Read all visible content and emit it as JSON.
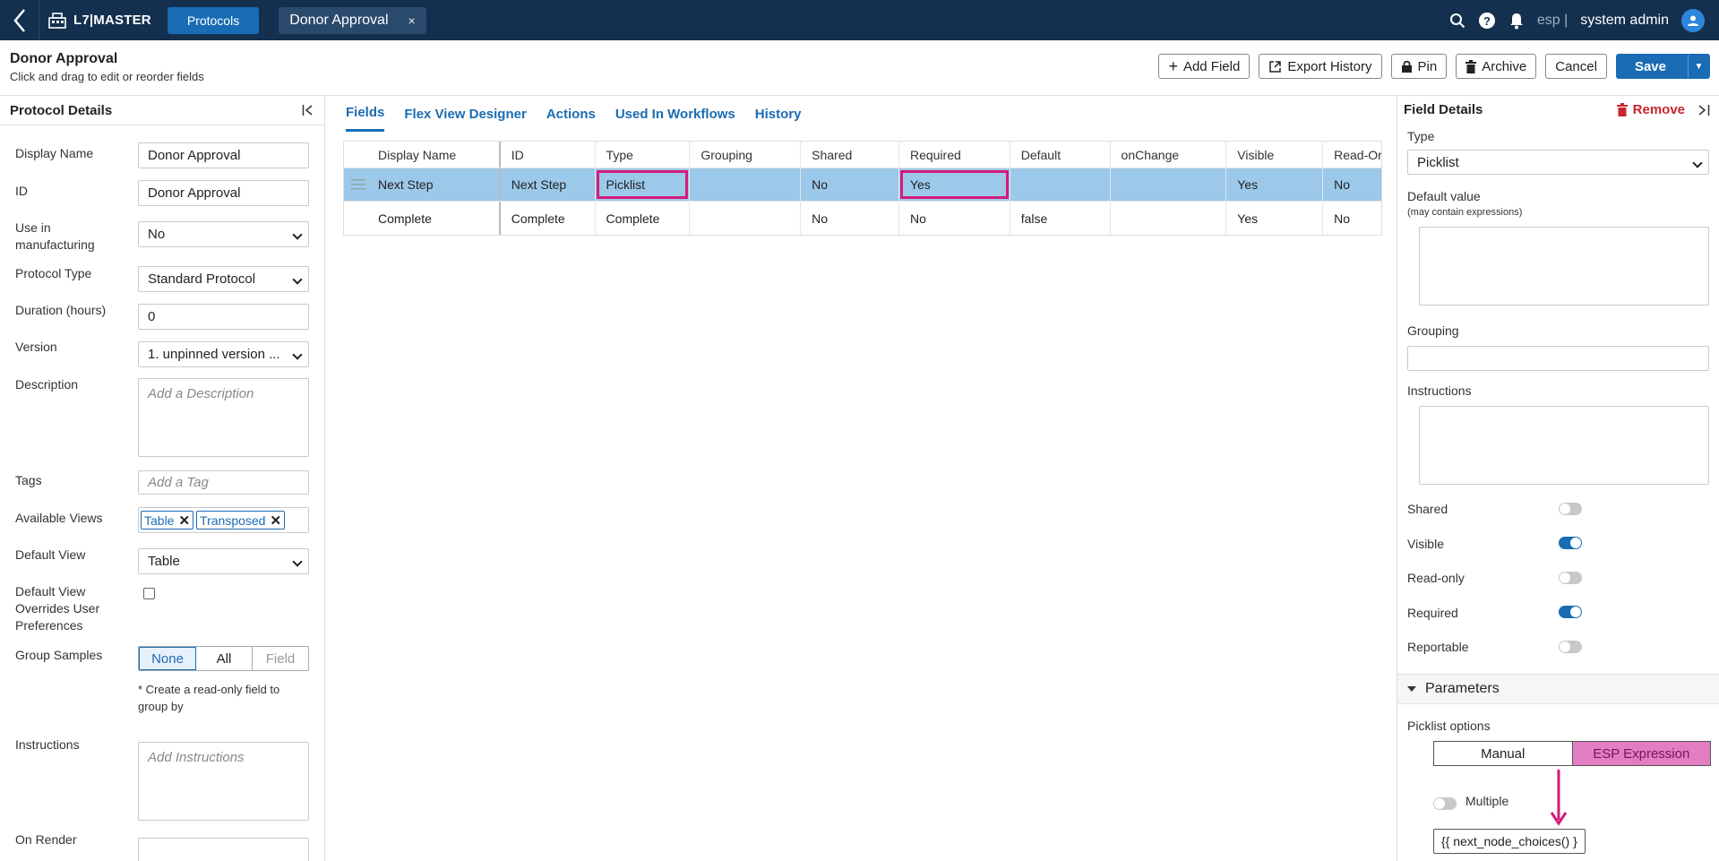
{
  "topbar": {
    "app_name": "L7|MASTER",
    "protocols_label": "Protocols",
    "doc_tab": "Donor Approval",
    "close_glyph": "×",
    "lang": "esp |",
    "user": "system admin"
  },
  "header": {
    "title": "Donor Approval",
    "subtitle": "Click and drag to edit or reorder fields",
    "buttons": {
      "add_field": "Add Field",
      "export_history": "Export History",
      "pin": "Pin",
      "archive": "Archive",
      "cancel": "Cancel",
      "save": "Save"
    }
  },
  "left": {
    "title": "Protocol Details",
    "display_name_label": "Display Name",
    "display_name": "Donor Approval",
    "id_label": "ID",
    "id": "Donor Approval",
    "manufacturing_label": "Use in manufacturing",
    "manufacturing": "No",
    "protocol_type_label": "Protocol Type",
    "protocol_type": "Standard Protocol",
    "duration_label": "Duration (hours)",
    "duration": "0",
    "version_label": "Version",
    "version": "1. unpinned version ...",
    "description_label": "Description",
    "description_placeholder": "Add a Description",
    "tags_label": "Tags",
    "tags_placeholder": "Add a Tag",
    "views_label": "Available Views",
    "views": [
      "Table",
      "Transposed"
    ],
    "default_view_label": "Default View",
    "default_view": "Table",
    "override_label": "Default View Overrides User Preferences",
    "group_label": "Group Samples",
    "group_options": [
      "None",
      "All",
      "Field"
    ],
    "group_note": "* Create a read-only field to group by",
    "instructions_label": "Instructions",
    "instructions_placeholder": "Add Instructions",
    "on_render_label": "On Render"
  },
  "center": {
    "tabs": [
      "Fields",
      "Flex View Designer",
      "Actions",
      "Used In Workflows",
      "History"
    ],
    "columns": [
      "Display Name",
      "ID",
      "Type",
      "Grouping",
      "Shared",
      "Required",
      "Default",
      "onChange",
      "Visible",
      "Read-Or"
    ],
    "rows": [
      [
        "Next Step",
        "Next Step",
        "Picklist",
        "",
        "No",
        "Yes",
        "",
        "",
        "Yes",
        "No"
      ],
      [
        "Complete",
        "Complete",
        "Complete",
        "",
        "No",
        "No",
        "false",
        "",
        "Yes",
        "No"
      ]
    ]
  },
  "right": {
    "title": "Field Details",
    "remove": "Remove",
    "type_label": "Type",
    "type": "Picklist",
    "default_label": "Default value",
    "default_hint": "(may contain expressions)",
    "grouping_label": "Grouping",
    "instructions_label": "Instructions",
    "toggles": [
      {
        "label": "Shared",
        "on": false
      },
      {
        "label": "Visible",
        "on": true
      },
      {
        "label": "Read-only",
        "on": false
      },
      {
        "label": "Required",
        "on": true
      },
      {
        "label": "Reportable",
        "on": false
      }
    ],
    "parameters_label": "Parameters",
    "picklist_label": "Picklist options",
    "picklist_modes": [
      "Manual",
      "ESP Expression"
    ],
    "multiple_label": "Multiple",
    "expression": "{{ next_node_choices() }"
  },
  "colors": {
    "brand": "#13304f",
    "accent": "#1a6cb4",
    "highlight": "#d41b7a"
  }
}
